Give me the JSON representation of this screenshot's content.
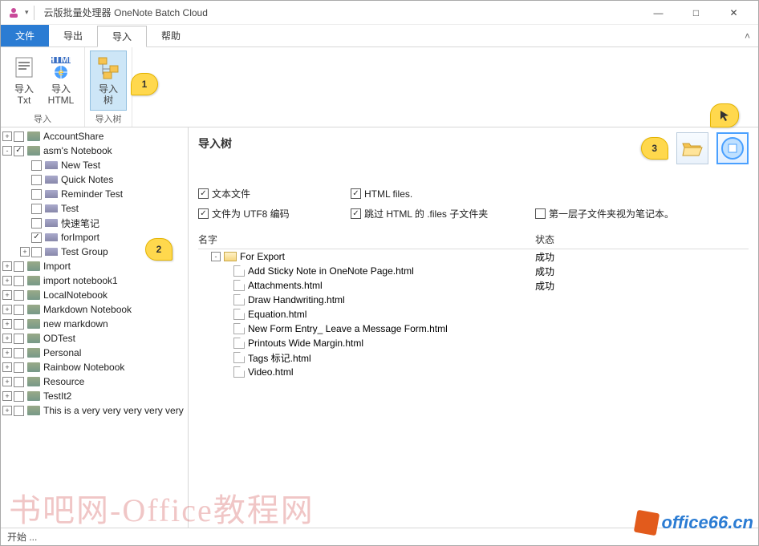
{
  "titlebar": {
    "app_prefix": "云版批量处理器",
    "app_name": "OneNote Batch Cloud"
  },
  "win": {
    "min": "—",
    "max": "□",
    "close": "✕"
  },
  "menubar": {
    "file": "文件",
    "export": "导出",
    "import": "导入",
    "help": "帮助"
  },
  "ribbon": {
    "import_txt": "导入\nTxt",
    "import_html": "导入\nHTML",
    "import_tree": "导入\n树",
    "group1": "导入",
    "group2": "导入树"
  },
  "tree": {
    "items": [
      {
        "level": 0,
        "expander": "+",
        "checked": false,
        "icon": "book",
        "label": "AccountShare"
      },
      {
        "level": 0,
        "expander": "-",
        "checked": true,
        "icon": "book",
        "label": "asm's Notebook"
      },
      {
        "level": 1,
        "expander": "",
        "checked": false,
        "icon": "section",
        "label": "New Test"
      },
      {
        "level": 1,
        "expander": "",
        "checked": false,
        "icon": "section",
        "label": "Quick Notes"
      },
      {
        "level": 1,
        "expander": "",
        "checked": false,
        "icon": "section",
        "label": "Reminder Test"
      },
      {
        "level": 1,
        "expander": "",
        "checked": false,
        "icon": "section",
        "label": "Test"
      },
      {
        "level": 1,
        "expander": "",
        "checked": false,
        "icon": "section",
        "label": "快速笔记"
      },
      {
        "level": 1,
        "expander": "",
        "checked": true,
        "icon": "section",
        "label": "forImport"
      },
      {
        "level": 1,
        "expander": "+",
        "checked": false,
        "icon": "section",
        "label": "Test Group"
      },
      {
        "level": 0,
        "expander": "+",
        "checked": false,
        "icon": "book",
        "label": "Import"
      },
      {
        "level": 0,
        "expander": "+",
        "checked": false,
        "icon": "book",
        "label": "import notebook1"
      },
      {
        "level": 0,
        "expander": "+",
        "checked": false,
        "icon": "book",
        "label": "LocalNotebook"
      },
      {
        "level": 0,
        "expander": "+",
        "checked": false,
        "icon": "book",
        "label": "Markdown Notebook"
      },
      {
        "level": 0,
        "expander": "+",
        "checked": false,
        "icon": "book",
        "label": "new markdown"
      },
      {
        "level": 0,
        "expander": "+",
        "checked": false,
        "icon": "book",
        "label": "ODTest"
      },
      {
        "level": 0,
        "expander": "+",
        "checked": false,
        "icon": "book",
        "label": "Personal"
      },
      {
        "level": 0,
        "expander": "+",
        "checked": false,
        "icon": "book",
        "label": "Rainbow Notebook"
      },
      {
        "level": 0,
        "expander": "+",
        "checked": false,
        "icon": "book",
        "label": "Resource"
      },
      {
        "level": 0,
        "expander": "+",
        "checked": false,
        "icon": "book",
        "label": "TestIt2"
      },
      {
        "level": 0,
        "expander": "+",
        "checked": false,
        "icon": "book",
        "label": "This is a very very very very very"
      }
    ]
  },
  "right": {
    "title": "导入树",
    "checks": {
      "text_files": "文本文件",
      "html_files": "HTML files.",
      "utf8": "文件为 UTF8 编码",
      "skip_files_subfolder": "跳过 HTML 的 .files 子文件夹",
      "first_level_as_notebook": "第一层子文件夹视为笔记本。"
    },
    "check_states": {
      "text_files": true,
      "html_files": true,
      "utf8": true,
      "skip_files_subfolder": true,
      "first_level_as_notebook": false
    },
    "columns": {
      "name": "名字",
      "status": "状态"
    },
    "rows": [
      {
        "type": "folder",
        "expander": "-",
        "indent": 1,
        "name": "For Export",
        "status": "成功"
      },
      {
        "type": "file",
        "indent": 2,
        "name": "Add Sticky Note in OneNote Page.html",
        "status": "成功"
      },
      {
        "type": "file",
        "indent": 2,
        "name": "Attachments.html",
        "status": "成功"
      },
      {
        "type": "file",
        "indent": 2,
        "name": "Draw Handwriting.html",
        "status": ""
      },
      {
        "type": "file",
        "indent": 2,
        "name": "Equation.html",
        "status": ""
      },
      {
        "type": "file",
        "indent": 2,
        "name": "New Form Entry_ Leave a Message Form.html",
        "status": ""
      },
      {
        "type": "file",
        "indent": 2,
        "name": "Printouts Wide Margin.html",
        "status": ""
      },
      {
        "type": "file",
        "indent": 2,
        "name": "Tags 标记.html",
        "status": ""
      },
      {
        "type": "file",
        "indent": 2,
        "name": "Video.html",
        "status": ""
      }
    ]
  },
  "callouts": {
    "c1": "1",
    "c2": "2",
    "c3": "3"
  },
  "statusbar": {
    "text": "开始 ..."
  },
  "watermark": {
    "left": "书吧网-Office教程网",
    "right": "office66.cn"
  }
}
